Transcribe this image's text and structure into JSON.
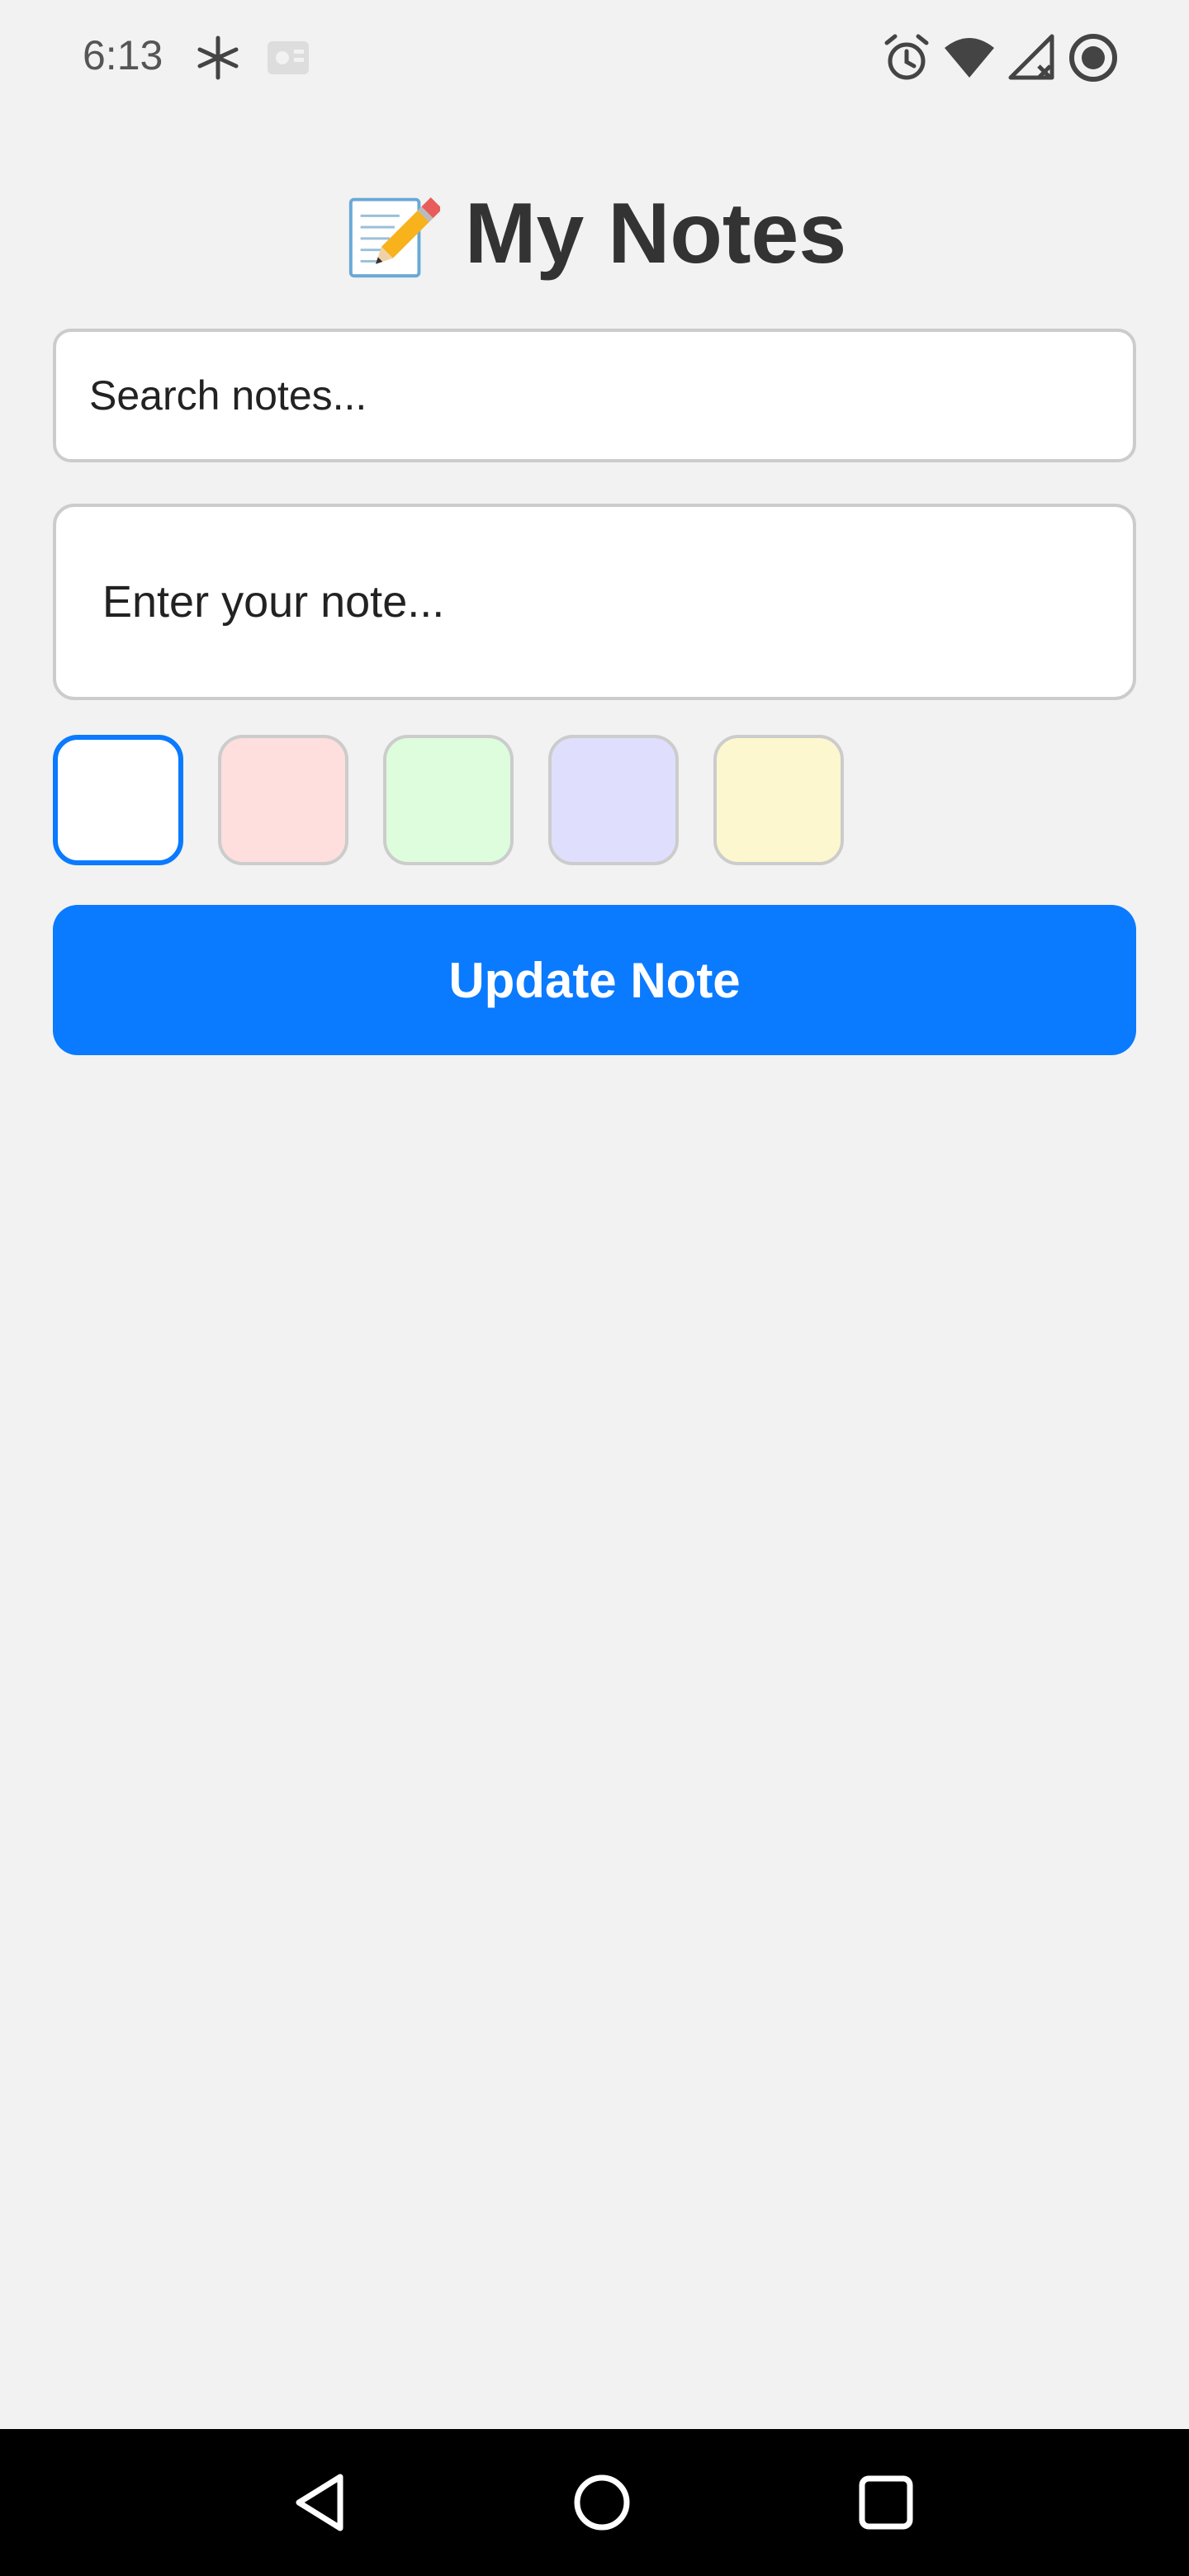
{
  "status_bar": {
    "time": "6:13",
    "icons_left": [
      "sparkle-icon",
      "notification-icon"
    ],
    "icons_right": [
      "alarm-icon",
      "wifi-icon",
      "cellular-no-signal-icon",
      "record-icon"
    ]
  },
  "header": {
    "icon": "memo-pencil-icon",
    "title": "My Notes"
  },
  "search": {
    "placeholder": "Search notes...",
    "value": ""
  },
  "note_editor": {
    "placeholder": "Enter your note...",
    "value": ""
  },
  "colors": {
    "selected_index": 0,
    "selected_border": "#0a7aff",
    "options": [
      "#ffffff",
      "#ffdede",
      "#ddfddd",
      "#dfdffd",
      "#fdf7cf"
    ]
  },
  "actions": {
    "update_label": "Update Note",
    "accent": "#0a7aff"
  },
  "nav_bar": {
    "buttons": [
      "back-icon",
      "home-icon",
      "recents-icon"
    ]
  }
}
